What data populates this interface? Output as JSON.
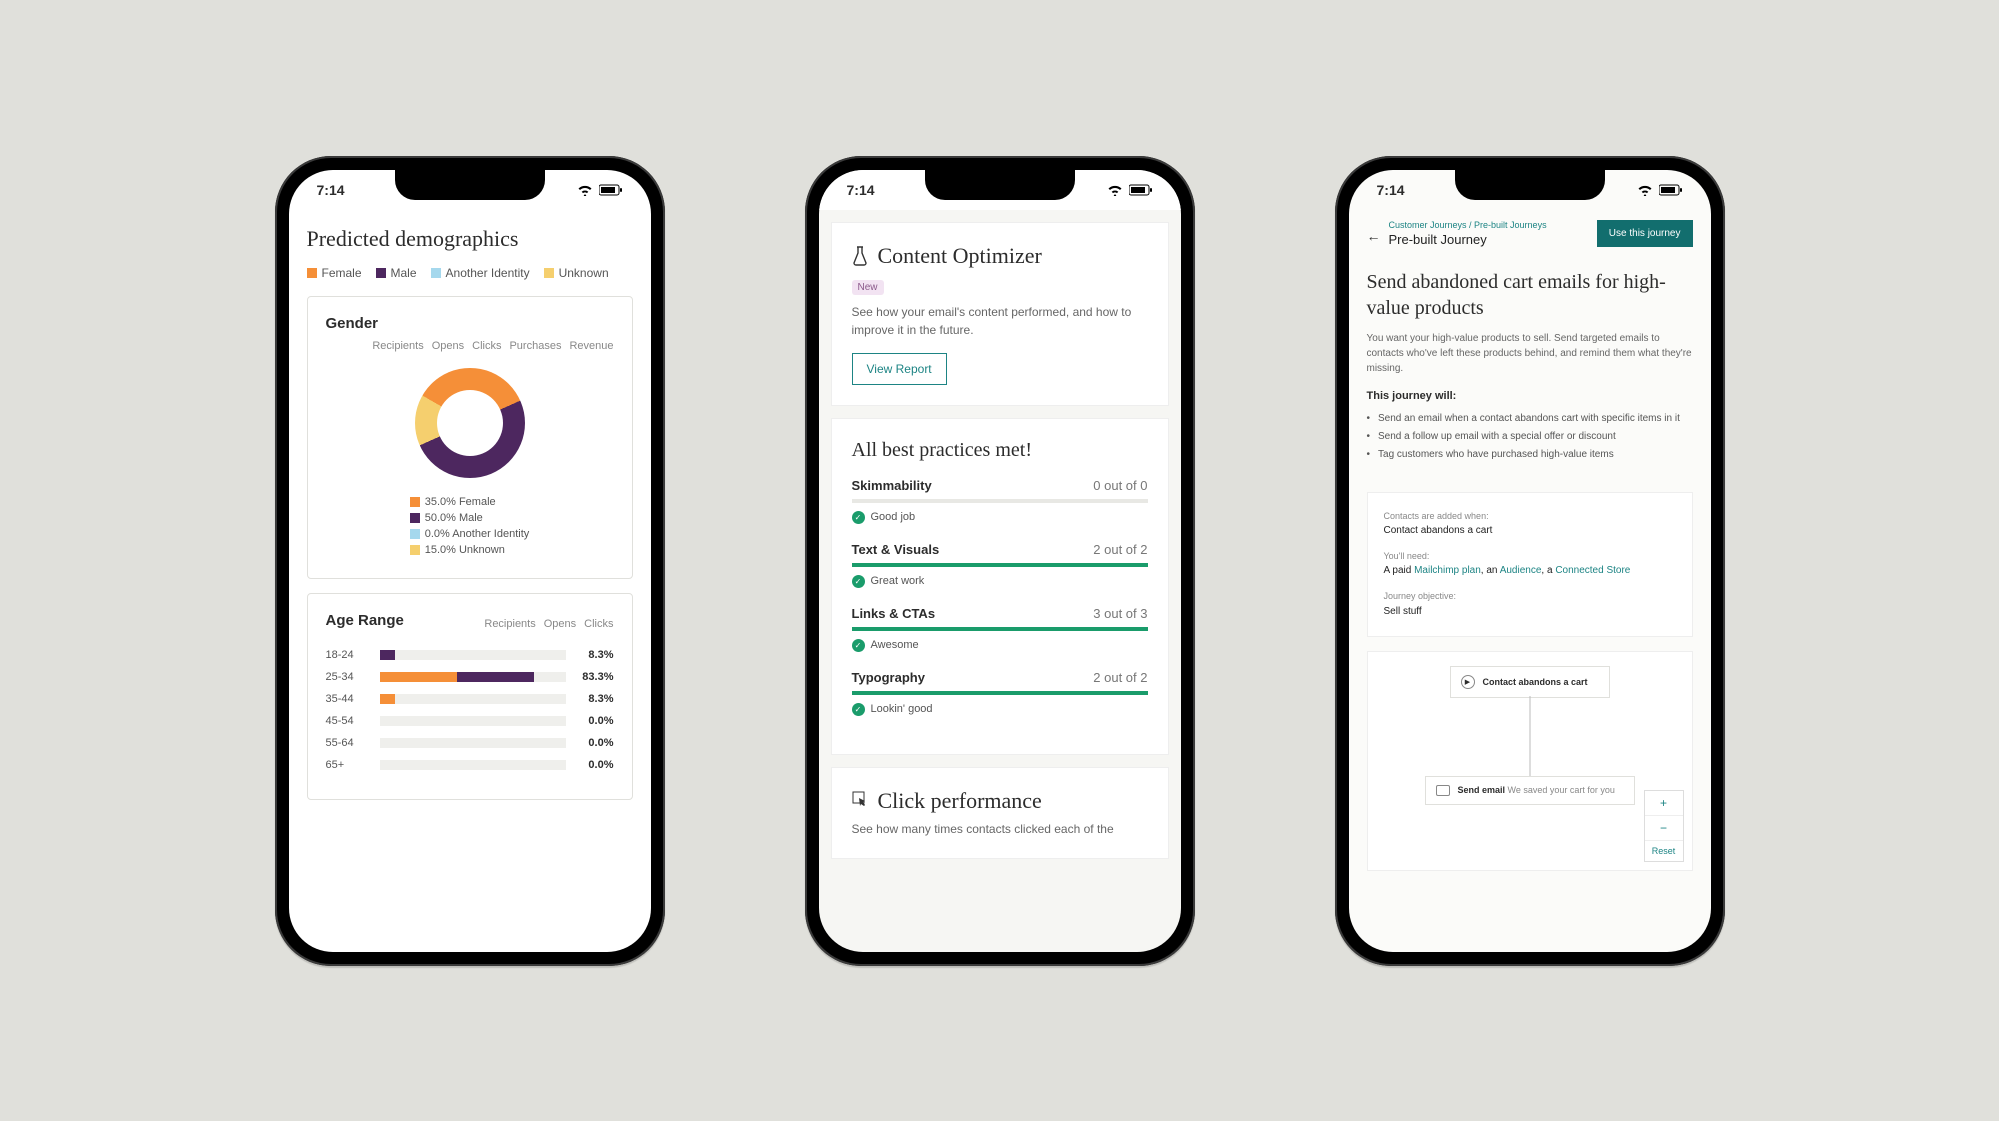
{
  "status": {
    "time": "7:14"
  },
  "colors": {
    "orange": "#f58f38",
    "purple": "#4d275f",
    "blue": "#a5d8ed",
    "yellow": "#f5cf6e",
    "green": "#1a9c6b",
    "teal": "#1d8484"
  },
  "phone1": {
    "title": "Predicted demographics",
    "legend": [
      "Female",
      "Male",
      "Another Identity",
      "Unknown"
    ],
    "gender": {
      "title": "Gender",
      "tabs": [
        "Recipients",
        "Opens",
        "Clicks",
        "Purchases",
        "Revenue"
      ],
      "breakdown": [
        {
          "label": "35.0% Female",
          "color": "orange",
          "pct": 35.0
        },
        {
          "label": "50.0% Male",
          "color": "purple",
          "pct": 50.0
        },
        {
          "label": "0.0% Another Identity",
          "color": "blue",
          "pct": 0.0
        },
        {
          "label": "15.0% Unknown",
          "color": "yellow",
          "pct": 15.0
        }
      ]
    },
    "age": {
      "title": "Age Range",
      "tabs": [
        "Recipients",
        "Opens",
        "Clicks"
      ],
      "rows": [
        {
          "label": "18-24",
          "value": "8.3%",
          "segments": [
            {
              "color": "purple",
              "pct": 8.3
            }
          ]
        },
        {
          "label": "25-34",
          "value": "83.3%",
          "segments": [
            {
              "color": "orange",
              "pct": 41.6
            },
            {
              "color": "purple",
              "pct": 41.7
            }
          ]
        },
        {
          "label": "35-44",
          "value": "8.3%",
          "segments": [
            {
              "color": "orange",
              "pct": 8.3
            }
          ]
        },
        {
          "label": "45-54",
          "value": "0.0%",
          "segments": []
        },
        {
          "label": "55-64",
          "value": "0.0%",
          "segments": []
        },
        {
          "label": "65+",
          "value": "0.0%",
          "segments": []
        }
      ]
    }
  },
  "phone2": {
    "contentOptimizer": {
      "title": "Content Optimizer",
      "badge": "New",
      "desc": "See how your email's content performed, and how to improve it in the future.",
      "button": "View Report"
    },
    "bestPractices": {
      "title": "All best practices met!",
      "rows": [
        {
          "name": "Skimmability",
          "score": "0 out of 0",
          "pct": 0,
          "status": "Good job",
          "barColor": "#e8e8e4"
        },
        {
          "name": "Text & Visuals",
          "score": "2 out of 2",
          "pct": 100,
          "status": "Great work",
          "barColor": "#1a9c6b"
        },
        {
          "name": "Links & CTAs",
          "score": "3 out of 3",
          "pct": 100,
          "status": "Awesome",
          "barColor": "#1a9c6b"
        },
        {
          "name": "Typography",
          "score": "2 out of 2",
          "pct": 100,
          "status": "Lookin' good",
          "barColor": "#1a9c6b"
        }
      ]
    },
    "clickPerformance": {
      "title": "Click performance",
      "desc": "See how many times contacts clicked each of the"
    }
  },
  "phone3": {
    "breadcrumb": "Customer Journeys / Pre-built Journeys",
    "breadcrumbTitle": "Pre-built Journey",
    "cta": "Use this journey",
    "hero": {
      "title": "Send abandoned cart emails for high-value products",
      "desc": "You want your high-value products to sell. Send targeted emails to contacts who've left these products behind, and remind them what they're missing.",
      "listTitle": "This journey will:",
      "list": [
        "Send an email when a contact abandons cart with specific items in it",
        "Send a follow up email with a special offer or discount",
        "Tag customers who have purchased high-value items"
      ]
    },
    "info": {
      "addedWhenLabel": "Contacts are added when:",
      "addedWhen": "Contact abandons a cart",
      "needLabel": "You'll need:",
      "needPrefix": "A paid ",
      "needLink1": "Mailchimp plan",
      "needSep1": ", an ",
      "needLink2": "Audience",
      "needSep2": ", a ",
      "needLink3": "Connected Store",
      "objLabel": "Journey objective:",
      "obj": "Sell stuff"
    },
    "flow": {
      "node1": "Contact abandons a cart",
      "node2a": "Send email",
      "node2b": "We saved your cart for you"
    },
    "zoom": {
      "in": "+",
      "out": "−",
      "reset": "Reset"
    }
  },
  "chart_data": [
    {
      "type": "pie",
      "title": "Gender",
      "series": [
        {
          "name": "Female",
          "value": 35.0
        },
        {
          "name": "Male",
          "value": 50.0
        },
        {
          "name": "Another Identity",
          "value": 0.0
        },
        {
          "name": "Unknown",
          "value": 15.0
        }
      ]
    },
    {
      "type": "bar",
      "title": "Age Range",
      "categories": [
        "18-24",
        "25-34",
        "35-44",
        "45-54",
        "55-64",
        "65+"
      ],
      "values": [
        8.3,
        83.3,
        8.3,
        0.0,
        0.0,
        0.0
      ],
      "ylabel": "%",
      "ylim": [
        0,
        100
      ]
    }
  ]
}
